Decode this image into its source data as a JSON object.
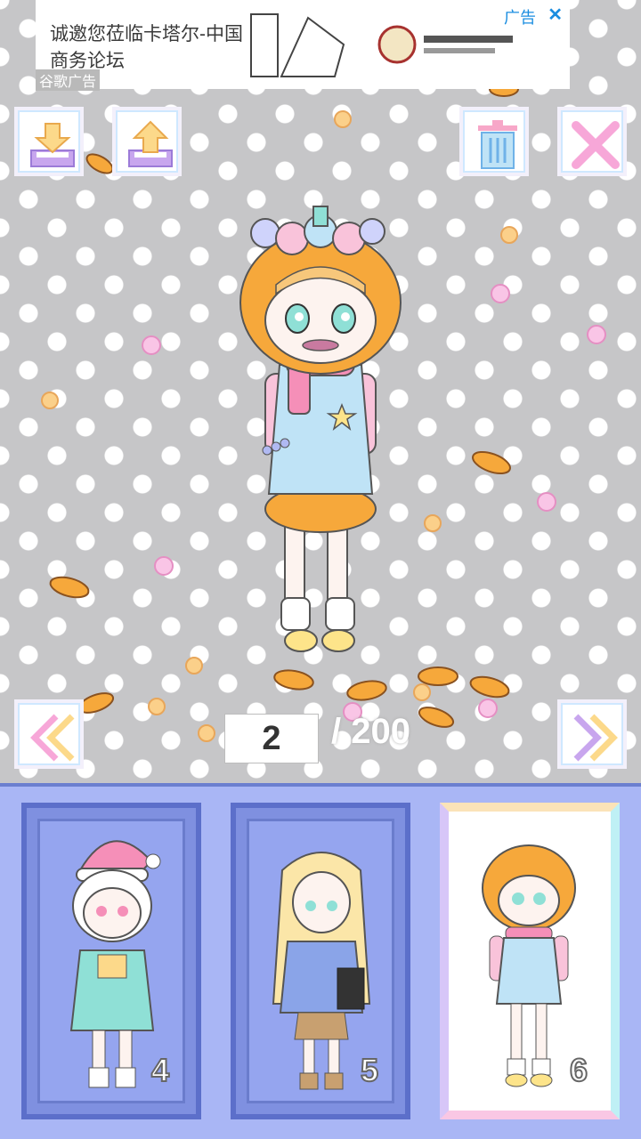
{
  "ad": {
    "headline": "诚邀您莅临卡塔尔-中国商务论坛",
    "google_tag": "谷歌广告",
    "label": "广告",
    "close": "✕"
  },
  "toolbar": {
    "download": "download-icon",
    "upload": "upload-icon",
    "delete": "trash-icon",
    "close": "close-icon"
  },
  "navigation": {
    "current_page": "2",
    "total_pages": "/ 200"
  },
  "slots": [
    {
      "number": "4",
      "outfit": "christmas-girl"
    },
    {
      "number": "5",
      "outfit": "blonde-girl"
    },
    {
      "number": "6",
      "outfit": "pumpkin-kid",
      "selected": true
    }
  ],
  "colors": {
    "panel": "#a9b6f5",
    "accent_pink": "#f7a7d8",
    "accent_orange": "#f6a83b",
    "accent_blue": "#8fd0ff"
  }
}
